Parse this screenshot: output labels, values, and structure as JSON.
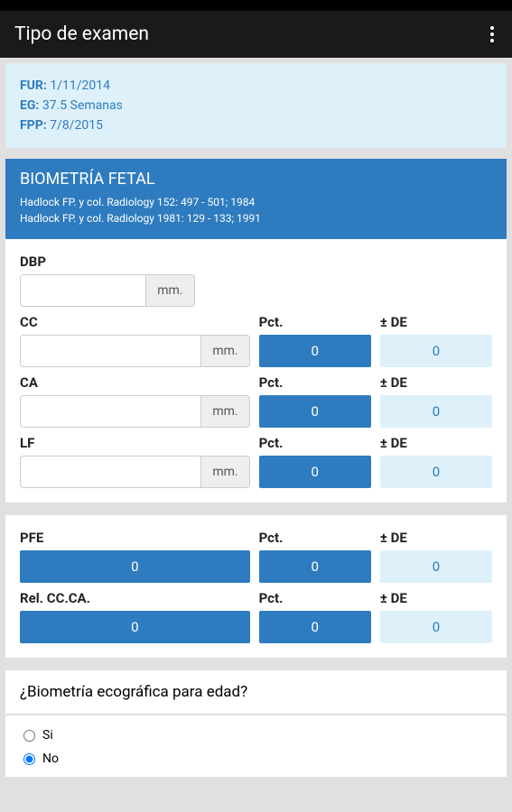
{
  "app": {
    "title": "Tipo de examen"
  },
  "info": {
    "fur_label": "FUR:",
    "fur_value": "1/11/2014",
    "eg_label": "EG:",
    "eg_value": "37.5 Semanas",
    "fpp_label": "FPP:",
    "fpp_value": "7/8/2015"
  },
  "section": {
    "title": "BIOMETRÍA FETAL",
    "ref1": "Hadlock FP. y col. Radiology 152: 497 - 501; 1984",
    "ref2": "Hadlock FP. y col. Radiology 1981: 129 - 133; 1991"
  },
  "labels": {
    "pct": "Pct.",
    "de": "± DE",
    "unit_mm": "mm."
  },
  "fields": {
    "dbp": {
      "label": "DBP",
      "value": ""
    },
    "cc": {
      "label": "CC",
      "value": "",
      "pct": "0",
      "de": "0"
    },
    "ca": {
      "label": "CA",
      "value": "",
      "pct": "0",
      "de": "0"
    },
    "lf": {
      "label": "LF",
      "value": "",
      "pct": "0",
      "de": "0"
    }
  },
  "derived": {
    "pfe": {
      "label": "PFE",
      "value": "0",
      "pct": "0",
      "de": "0"
    },
    "rel": {
      "label": "Rel. CC.CA.",
      "value": "0",
      "pct": "0",
      "de": "0"
    }
  },
  "question": {
    "text": "¿Biometría ecográfica para edad?",
    "option_si": "Si",
    "option_no": "No"
  }
}
